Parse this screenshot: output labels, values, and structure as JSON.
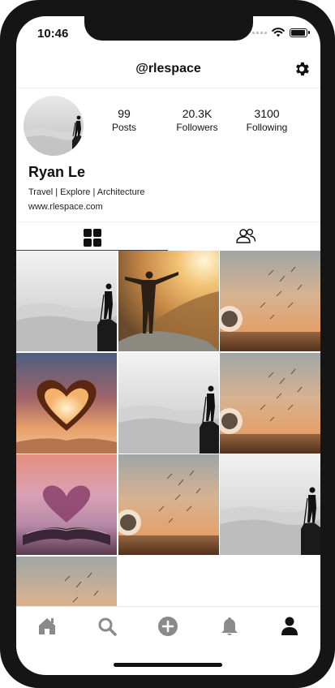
{
  "status_bar": {
    "time": "10:46"
  },
  "header": {
    "handle": "@rlespace"
  },
  "profile": {
    "name": "Ryan Le",
    "bio": "Travel | Explore | Architecture",
    "website": "www.rlespace.com",
    "stats": [
      {
        "value": "99",
        "label": "Posts"
      },
      {
        "value": "20.3K",
        "label": "Followers"
      },
      {
        "value": "3100",
        "label": "Following"
      }
    ]
  },
  "tabs": [
    {
      "icon": "grid-icon",
      "selected": true
    },
    {
      "icon": "tagged-people-icon",
      "selected": false
    }
  ],
  "photos": [
    {
      "scene": "mist-hiker"
    },
    {
      "scene": "sunset-cheering-man"
    },
    {
      "scene": "dandelion"
    },
    {
      "scene": "heart-hands-sunset"
    },
    {
      "scene": "mist-hiker"
    },
    {
      "scene": "dandelion"
    },
    {
      "scene": "book-heart"
    },
    {
      "scene": "dandelion"
    },
    {
      "scene": "mist-hiker"
    },
    {
      "scene": "dandelion"
    }
  ],
  "bottom_nav": [
    {
      "icon": "home-icon"
    },
    {
      "icon": "search-icon"
    },
    {
      "icon": "add-icon"
    },
    {
      "icon": "bell-icon"
    },
    {
      "icon": "profile-icon",
      "active": true
    }
  ],
  "colors": {
    "inactive_icon": "#8a8a8a",
    "active_icon": "#111111"
  }
}
